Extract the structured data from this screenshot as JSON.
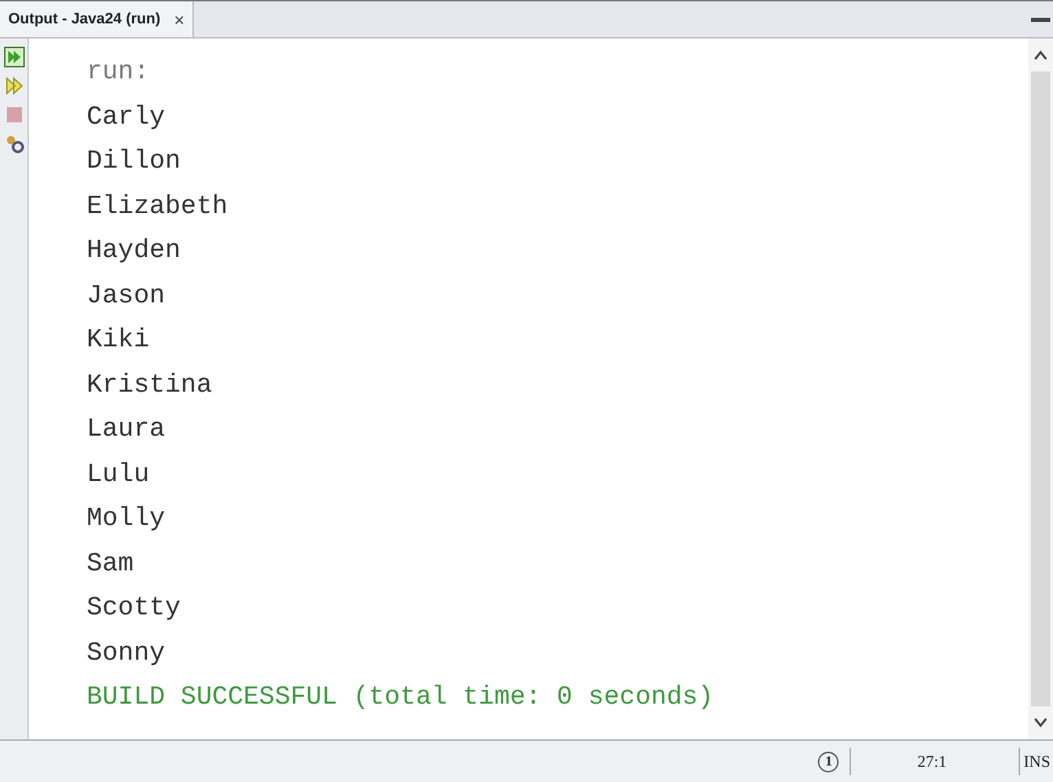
{
  "tab": {
    "title": "Output - Java24 (run)",
    "close": "×"
  },
  "lines": [
    {
      "kind": "system",
      "text": "run:"
    },
    {
      "kind": "output",
      "text": "Carly"
    },
    {
      "kind": "output",
      "text": "Dillon"
    },
    {
      "kind": "output",
      "text": "Elizabeth"
    },
    {
      "kind": "output",
      "text": "Hayden"
    },
    {
      "kind": "output",
      "text": "Jason"
    },
    {
      "kind": "output",
      "text": "Kiki"
    },
    {
      "kind": "output",
      "text": "Kristina"
    },
    {
      "kind": "output",
      "text": "Laura"
    },
    {
      "kind": "output",
      "text": "Lulu"
    },
    {
      "kind": "output",
      "text": "Molly"
    },
    {
      "kind": "output",
      "text": "Sam"
    },
    {
      "kind": "output",
      "text": "Scotty"
    },
    {
      "kind": "output",
      "text": "Sonny"
    },
    {
      "kind": "success",
      "text": "BUILD SUCCESSFUL (total time: 0 seconds)"
    }
  ],
  "status_bar": {
    "notifications": "1",
    "position": "27:1",
    "mode": "INS"
  }
}
